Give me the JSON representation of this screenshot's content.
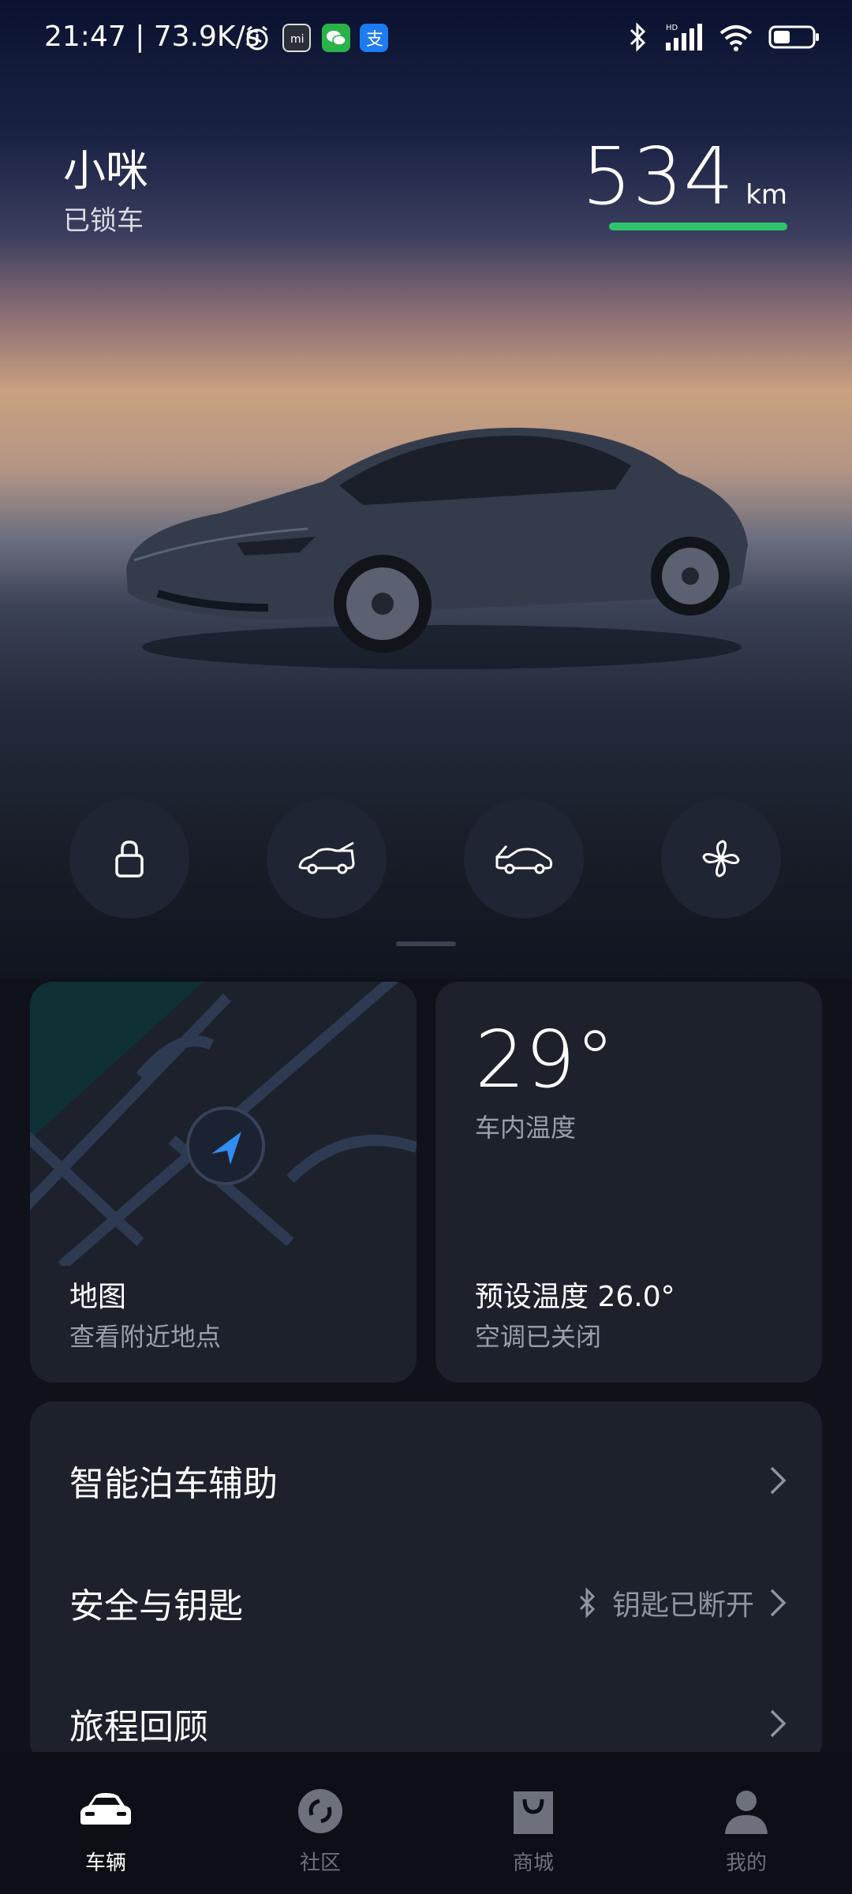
{
  "status_bar": {
    "time_speed": "21:47 | 73.9K/s",
    "icons": [
      "alarm-icon",
      "mi-icon",
      "wechat-icon",
      "alipay-icon",
      "bluetooth-icon",
      "hd-signal-icon",
      "wifi-icon",
      "battery-icon"
    ]
  },
  "vehicle": {
    "name": "小咪",
    "lock_status": "已锁车",
    "range_value": "534",
    "range_unit": "km",
    "range_bar_color": "#2ec36b"
  },
  "quick_controls": [
    {
      "name": "lock-icon"
    },
    {
      "name": "trunk-icon"
    },
    {
      "name": "frunk-icon"
    },
    {
      "name": "fan-icon"
    }
  ],
  "map_card": {
    "title": "地图",
    "subtitle": "查看附近地点"
  },
  "temp_card": {
    "value": "29°",
    "label": "车内温度",
    "preset": "预设温度 26.0°",
    "ac_status": "空调已关闭"
  },
  "menu": [
    {
      "label": "智能泊车辅助",
      "right": ""
    },
    {
      "label": "安全与钥匙",
      "right": "钥匙已断开"
    },
    {
      "label": "旅程回顾",
      "right": ""
    }
  ],
  "tabs": [
    {
      "label": "车辆",
      "active": true
    },
    {
      "label": "社区",
      "active": false
    },
    {
      "label": "商城",
      "active": false
    },
    {
      "label": "我的",
      "active": false
    }
  ]
}
